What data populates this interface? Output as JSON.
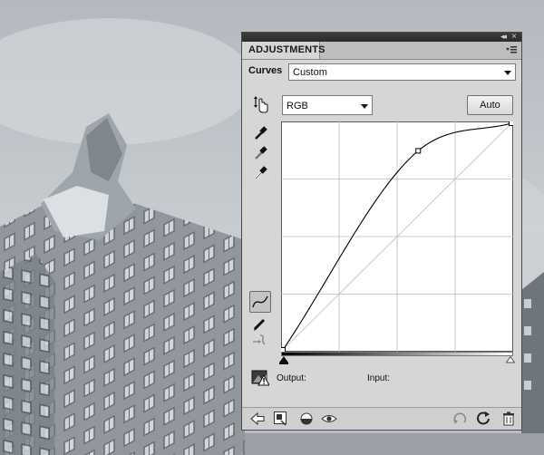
{
  "panel": {
    "tab_label": "ADJUSTMENTS",
    "adjustment_name": "Curves",
    "preset_value": "Custom",
    "channel_value": "RGB",
    "auto_label": "Auto",
    "output_label": "Output:",
    "input_label": "Input:"
  },
  "icons": {
    "titlebar": [
      "collapse-icon",
      "close-icon",
      "panel-menu-icon"
    ],
    "left_tools": [
      "on-image-adjust-icon",
      "black-eyedropper-icon",
      "gray-eyedropper-icon",
      "white-eyedropper-icon",
      "curve-point-tool-icon",
      "pencil-icon",
      "smooth-curve-icon"
    ],
    "bottom": [
      "back-arrow-icon",
      "clip-to-layer-icon",
      "visibility-eye-icon",
      "view-previous-icon",
      "reset-icon",
      "delete-icon"
    ]
  },
  "colors": {
    "panel_bg": "#d6d6d6",
    "titlebar": "#2f2f2f",
    "curve": "#000000",
    "grid": "#bdbdbd"
  },
  "curve": {
    "control_points": [
      [
        0,
        0
      ],
      [
        151,
        224
      ],
      [
        255,
        255
      ]
    ],
    "input_range": [
      0,
      255
    ],
    "output_range": [
      0,
      255
    ]
  }
}
